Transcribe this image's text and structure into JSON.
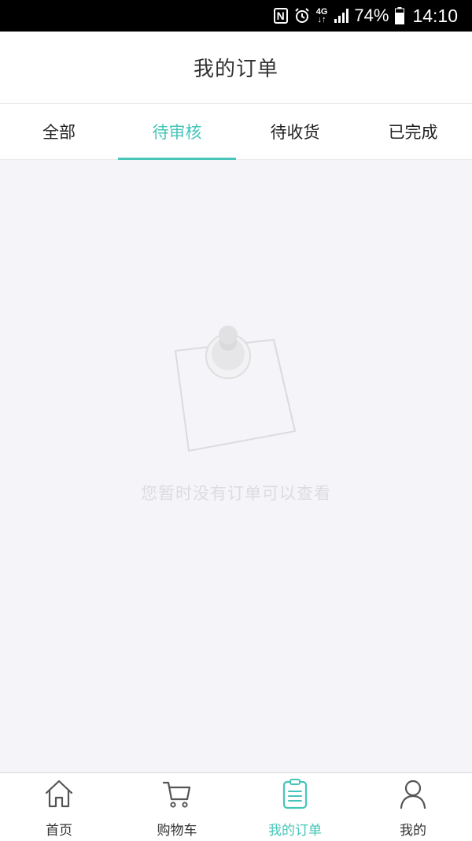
{
  "status_bar": {
    "icons": [
      "nfc-icon",
      "alarm-icon",
      "network-4g-icon",
      "signal-icon",
      "battery-icon"
    ],
    "nfc_letter": "N",
    "network_label": "4G",
    "battery": "74%",
    "time": "14:10"
  },
  "header": {
    "title": "我的订单"
  },
  "tabs": [
    {
      "label": "全部",
      "active": false
    },
    {
      "label": "待审核",
      "active": true
    },
    {
      "label": "待收货",
      "active": false
    },
    {
      "label": "已完成",
      "active": false
    }
  ],
  "empty_state": {
    "icon": "pinned-note-icon",
    "message": "您暂时没有订单可以查看"
  },
  "bottom_nav": [
    {
      "label": "首页",
      "icon": "home-icon",
      "active": false
    },
    {
      "label": "购物车",
      "icon": "cart-icon",
      "active": false
    },
    {
      "label": "我的订单",
      "icon": "order-list-icon",
      "active": true
    },
    {
      "label": "我的",
      "icon": "user-icon",
      "active": false
    }
  ],
  "colors": {
    "accent": "#46c5b8",
    "background": "#f5f5f9",
    "text": "#333333"
  }
}
